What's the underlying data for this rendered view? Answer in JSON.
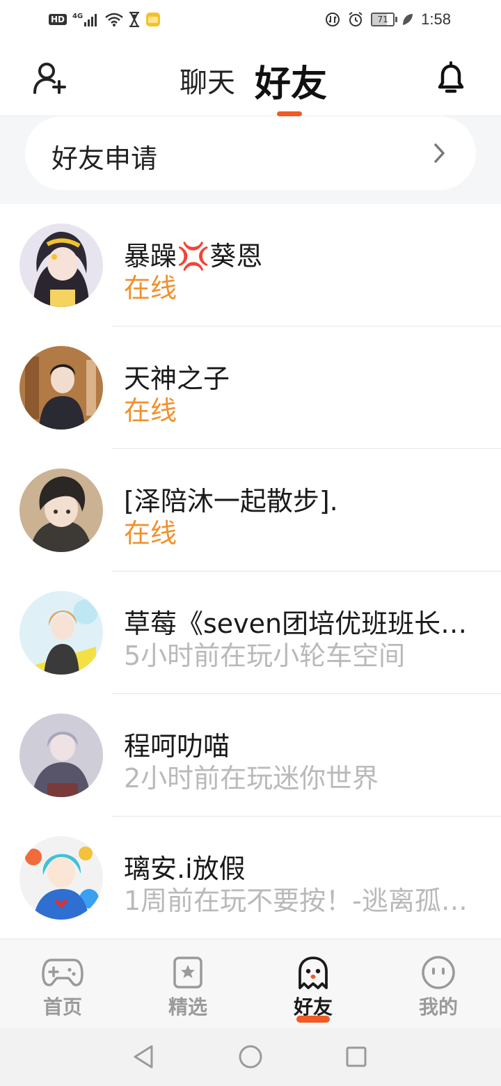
{
  "status_bar": {
    "hd": "HD",
    "network": "4G",
    "battery": "71",
    "time": "1:58"
  },
  "header": {
    "tab_chat": "聊天",
    "tab_friends": "好友",
    "active_tab": "好友"
  },
  "friend_request": {
    "label": "好友申请"
  },
  "friends": [
    {
      "name": "暴躁💢葵恩",
      "status": "在线",
      "online": true
    },
    {
      "name": "天神之子",
      "status": "在线",
      "online": true
    },
    {
      "name": "[泽陪沐一起散步].",
      "status": "在线",
      "online": true
    },
    {
      "name": "草莓《seven团培优班班长…",
      "status": "5小时前在玩小轮车空间",
      "online": false
    },
    {
      "name": "程呵叻喵",
      "status": "2小时前在玩迷你世界",
      "online": false
    },
    {
      "name": "璃安.i放假",
      "status": "1周前在玩不要按！-逃离孤…",
      "online": false
    }
  ],
  "bottom_nav": {
    "items": [
      {
        "label": "首页",
        "icon": "gamepad-icon"
      },
      {
        "label": "精选",
        "icon": "star-bookmark-icon"
      },
      {
        "label": "好友",
        "icon": "ghost-icon"
      },
      {
        "label": "我的",
        "icon": "face-icon"
      }
    ],
    "active": "好友"
  },
  "colors": {
    "accent": "#f15a22",
    "online": "#f0912e",
    "offline": "#b9b9b9"
  }
}
